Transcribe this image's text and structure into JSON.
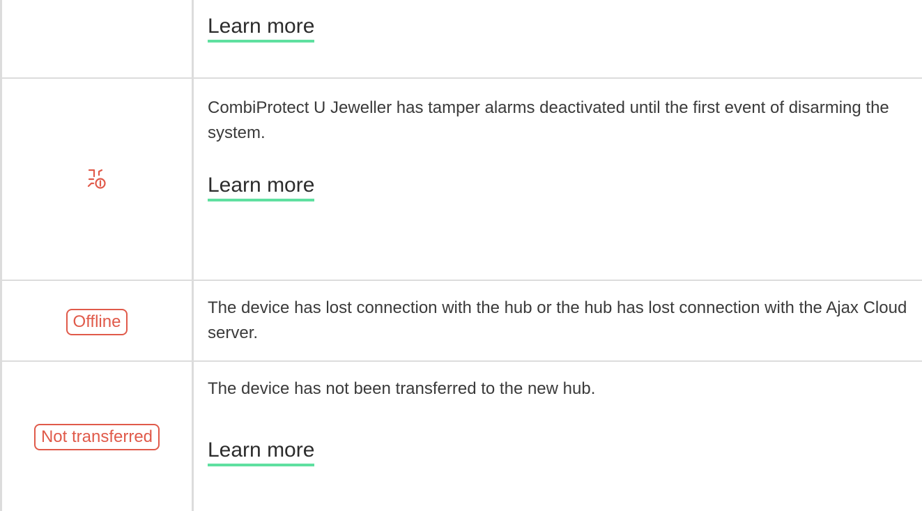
{
  "colors": {
    "accent_underline": "#5fe0a0",
    "status_red": "#e05a4a",
    "border": "#dcdcdc",
    "text": "#3a3a3a"
  },
  "rows": {
    "top": {
      "link_label": "Learn more"
    },
    "tamper": {
      "icon": "tamper-alarm-deactivated-icon",
      "description": "CombiProtect U Jeweller has tamper alarms deactivated until the first event of disarming the system.",
      "link_label": "Learn more"
    },
    "offline": {
      "badge": "Offline",
      "description": "The device has lost connection with the hub or the hub has lost connection with the Ajax Cloud server."
    },
    "not_transferred": {
      "badge": "Not transferred",
      "description": "The device has not been transferred to the new hub.",
      "link_label": "Learn more"
    }
  }
}
